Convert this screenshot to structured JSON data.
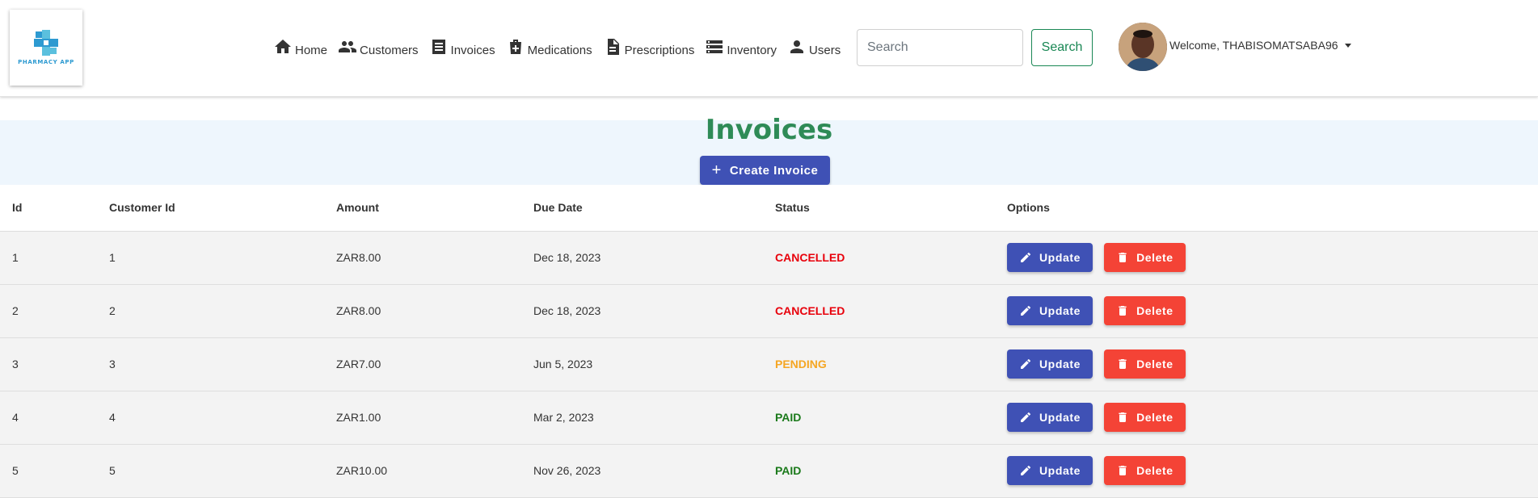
{
  "logo": {
    "text": "PHARMACY APP",
    "icon": "pharmacy-cross-logo"
  },
  "nav": {
    "items": [
      {
        "label": "Home",
        "icon": "home-icon"
      },
      {
        "label": "Customers",
        "icon": "people-icon"
      },
      {
        "label": "Invoices",
        "icon": "list-icon"
      },
      {
        "label": "Medications",
        "icon": "medical-bag-icon"
      },
      {
        "label": "Prescriptions",
        "icon": "document-icon"
      },
      {
        "label": "Inventory",
        "icon": "storage-icon"
      },
      {
        "label": "Users",
        "icon": "person-icon"
      }
    ]
  },
  "search": {
    "placeholder": "Search",
    "value": "",
    "button_label": "Search"
  },
  "user": {
    "welcome": "Welcome, THABISOMATSABA96"
  },
  "page": {
    "title": "Invoices",
    "create_label": "Create Invoice"
  },
  "table": {
    "headers": {
      "id": "Id",
      "customer_id": "Customer Id",
      "amount": "Amount",
      "due_date": "Due Date",
      "status": "Status",
      "options": "Options"
    },
    "rows": [
      {
        "id": "1",
        "customer_id": "1",
        "amount": "ZAR8.00",
        "due_date": "Dec 18, 2023",
        "status": "CANCELLED"
      },
      {
        "id": "2",
        "customer_id": "2",
        "amount": "ZAR8.00",
        "due_date": "Dec 18, 2023",
        "status": "CANCELLED"
      },
      {
        "id": "3",
        "customer_id": "3",
        "amount": "ZAR7.00",
        "due_date": "Jun 5, 2023",
        "status": "PENDING"
      },
      {
        "id": "4",
        "customer_id": "4",
        "amount": "ZAR1.00",
        "due_date": "Mar 2, 2023",
        "status": "PAID"
      },
      {
        "id": "5",
        "customer_id": "5",
        "amount": "ZAR10.00",
        "due_date": "Nov 26, 2023",
        "status": "PAID"
      }
    ],
    "update_label": "Update",
    "delete_label": "Delete"
  },
  "colors": {
    "title": "#2e8b57",
    "primary": "#3f51b5",
    "danger": "#f44336",
    "success_outline": "#198754",
    "status_cancelled": "#e8000b",
    "status_pending": "#f5a623",
    "status_paid": "#1b7a1b",
    "title_band": "#eef6fd",
    "row_bg": "#f3f3f3"
  }
}
